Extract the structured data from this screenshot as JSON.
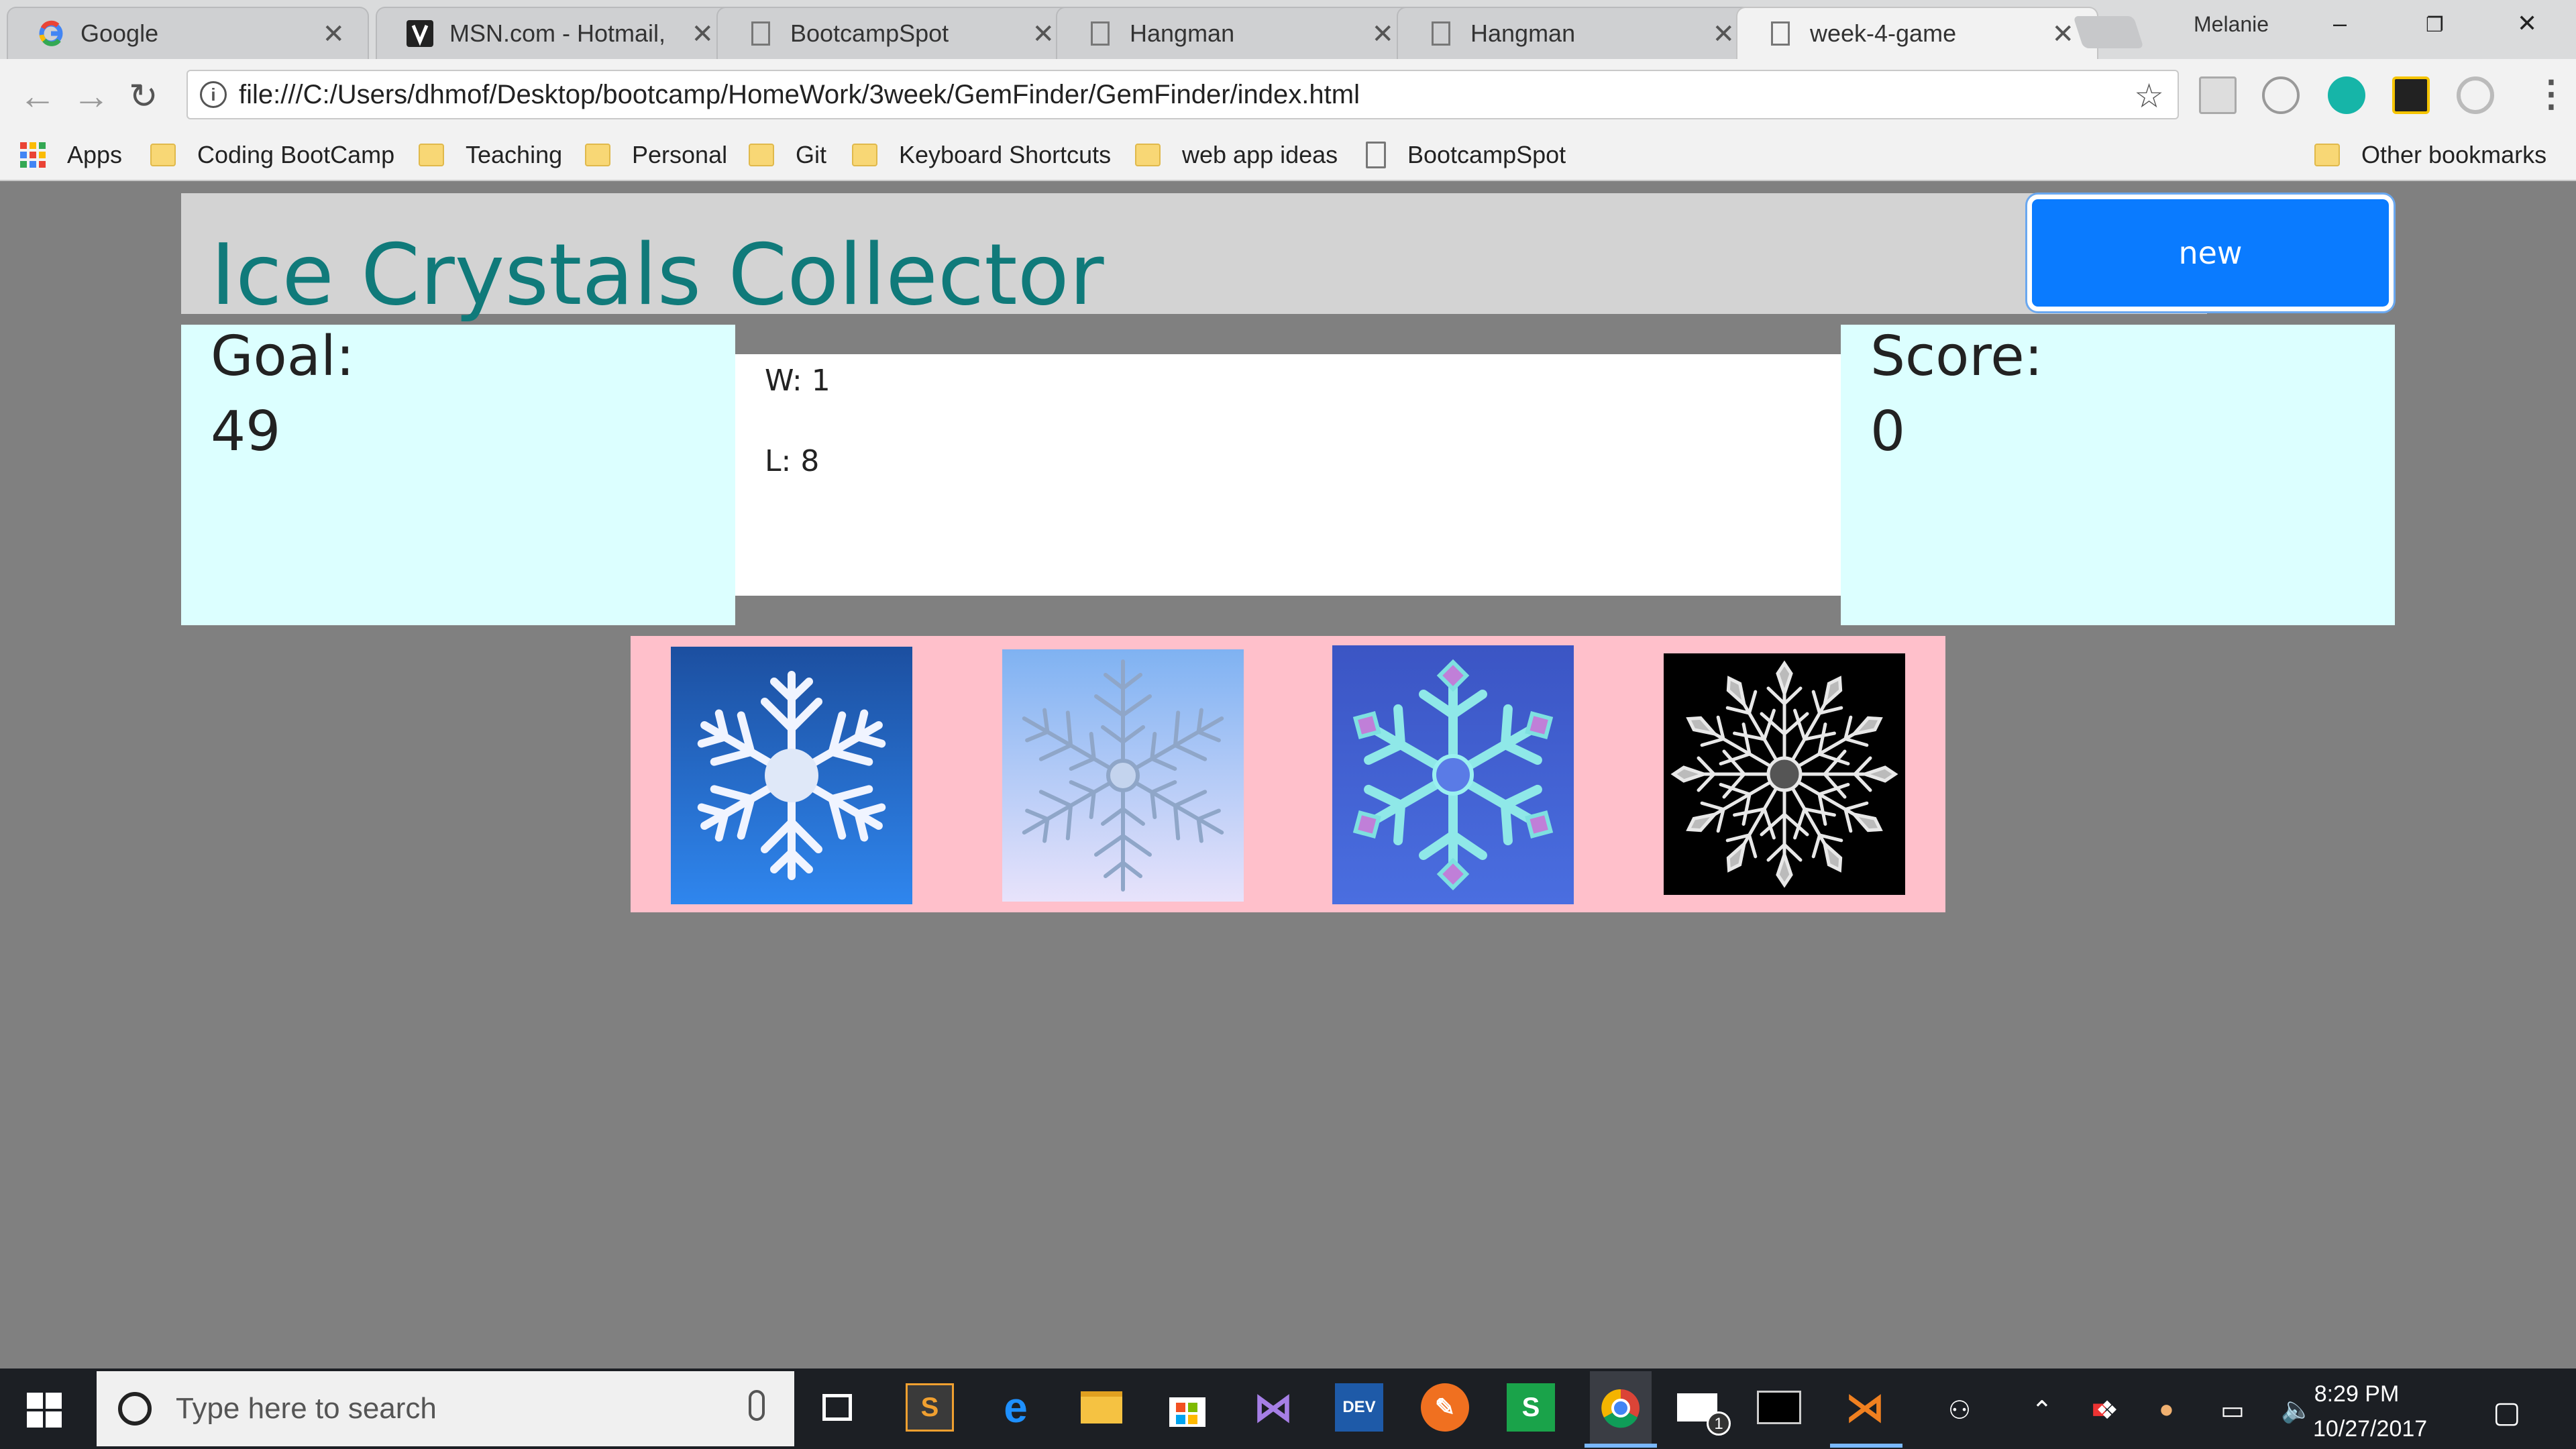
{
  "browser": {
    "tabs": [
      {
        "title": "Google",
        "icon": "google-icon",
        "active": false
      },
      {
        "title": "MSN.com - Hotmail,",
        "icon": "msn-icon",
        "active": false
      },
      {
        "title": "BootcampSpot",
        "icon": "page-icon",
        "active": false
      },
      {
        "title": "Hangman",
        "icon": "page-icon",
        "active": false
      },
      {
        "title": "Hangman",
        "icon": "page-icon",
        "active": false
      },
      {
        "title": "week-4-game",
        "icon": "page-icon",
        "active": true
      }
    ],
    "profile_name": "Melanie",
    "url": "file:///C:/Users/dhmof/Desktop/bootcamp/HomeWork/3week/GemFinder/GemFinder/index.html",
    "bookmarks": [
      {
        "label": "Apps",
        "type": "apps"
      },
      {
        "label": "Coding BootCamp",
        "type": "folder"
      },
      {
        "label": "Teaching",
        "type": "folder"
      },
      {
        "label": "Personal",
        "type": "folder"
      },
      {
        "label": "Git",
        "type": "folder"
      },
      {
        "label": "Keyboard Shortcuts",
        "type": "folder"
      },
      {
        "label": "web app ideas",
        "type": "folder"
      },
      {
        "label": "BootcampSpot",
        "type": "page"
      }
    ],
    "other_bookmarks": "Other bookmarks"
  },
  "game": {
    "title": "Ice Crystals Collector",
    "new_button": "new",
    "goal_label": "Goal:",
    "goal_value": "49",
    "wins": "W: 1",
    "losses": "L: 8",
    "score_label": "Score:",
    "score_value": "0",
    "crystals": [
      {
        "name": "crystal-1",
        "bg": "#2a6fd8"
      },
      {
        "name": "crystal-2",
        "bg": "#a9c8f5"
      },
      {
        "name": "crystal-3",
        "bg": "#3d5fd0"
      },
      {
        "name": "crystal-4",
        "bg": "#000000"
      }
    ],
    "colors": {
      "title": "#107a7a",
      "button": "#0a7bff",
      "panel": "#dcffff",
      "crystal_row": "#ffc0cb",
      "page_bg": "#808080"
    }
  },
  "taskbar": {
    "search_placeholder": "Type here to search",
    "time": "8:29 PM",
    "date": "10/27/2017",
    "mail_badge": "1"
  }
}
